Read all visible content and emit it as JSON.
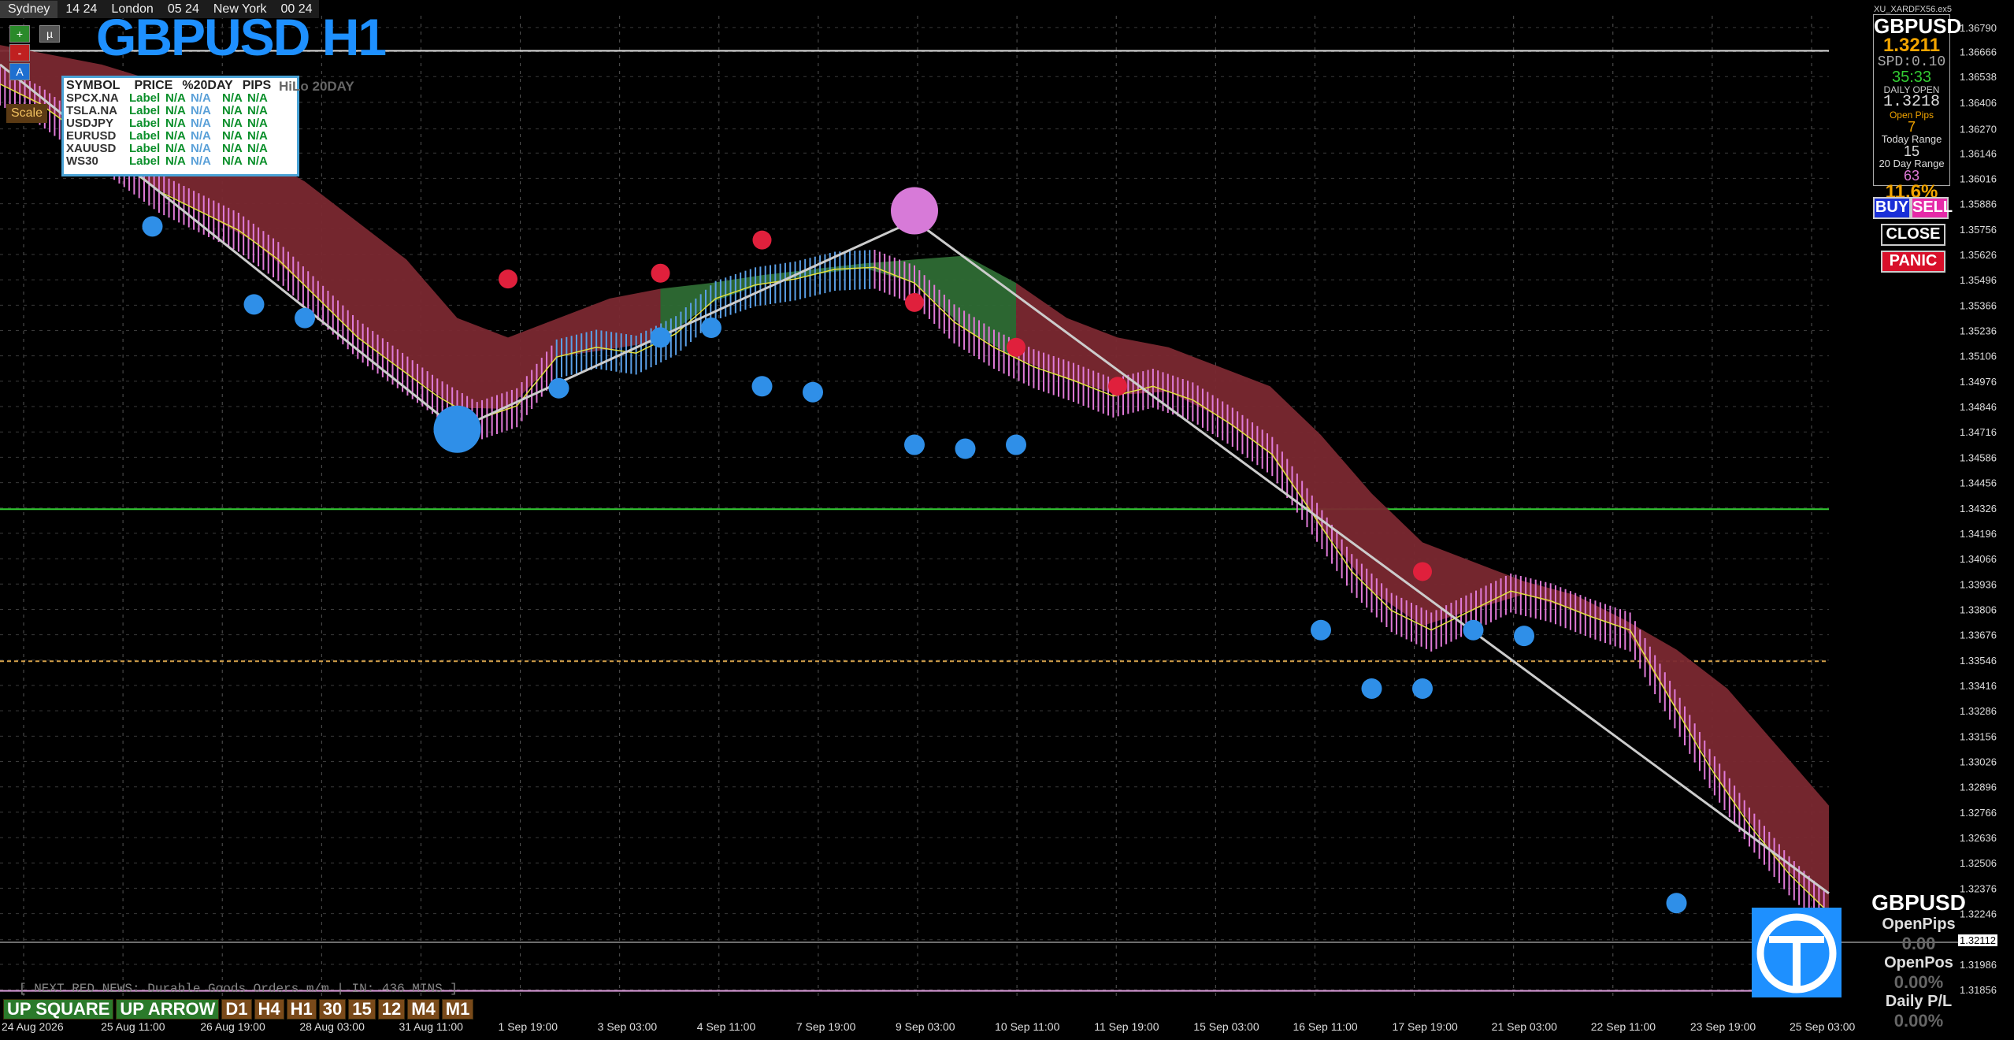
{
  "session": {
    "sydney_label": "Sydney",
    "sydney_time": "14 24",
    "london_label": "London",
    "london_time": "05 24",
    "ny_label": "New York",
    "ny_time": "00 24"
  },
  "title": "GBPUSD H1",
  "buttons": {
    "plus": "+",
    "mu": "µ",
    "minus": "-",
    "a": "A",
    "scale": "Scale"
  },
  "table": {
    "headers": [
      "SYMBOL",
      "PRICE",
      "%20DAY",
      "PIPS",
      "HiLo 20DAY"
    ],
    "rows": [
      {
        "symbol": "SPCX.NA",
        "price": "Label",
        "pct": "N/A",
        "pips": "N/A",
        "hilo": "N/A",
        "x": "N/A"
      },
      {
        "symbol": "TSLA.NA",
        "price": "Label",
        "pct": "N/A",
        "pips": "N/A",
        "hilo": "N/A",
        "x": "N/A"
      },
      {
        "symbol": "USDJPY",
        "price": "Label",
        "pct": "N/A",
        "pips": "N/A",
        "hilo": "N/A",
        "x": "N/A"
      },
      {
        "symbol": "EURUSD",
        "price": "Label",
        "pct": "N/A",
        "pips": "N/A",
        "hilo": "N/A",
        "x": "N/A"
      },
      {
        "symbol": "XAUUSD",
        "price": "Label",
        "pct": "N/A",
        "pips": "N/A",
        "hilo": "N/A",
        "x": "N/A"
      },
      {
        "symbol": "WS30",
        "price": "Label",
        "pct": "N/A",
        "pips": "N/A",
        "hilo": "N/A",
        "x": "N/A"
      }
    ]
  },
  "right_panel": {
    "broker": "XU_XARDFX56.ex5",
    "symbol": "GBPUSD",
    "price": "1.3211",
    "spread": "SPD:0.10",
    "timer": "35:33",
    "daily_open_label": "DAILY OPEN",
    "daily_open": "1.3218",
    "open_pips_label": "Open Pips",
    "open_pips": "7",
    "today_range_label": "Today Range",
    "today_range": "15",
    "day20_range_label": "20 Day Range",
    "day20_range": "63",
    "pct": "11.6%"
  },
  "trade_buttons": {
    "buy": "BUY",
    "sell": "SELL",
    "close": "CLOSE",
    "panic": "PANIC"
  },
  "bottom_panel": {
    "symbol": "GBPUSD",
    "open_pips_label": "OpenPips",
    "open_pips": "0.00",
    "open_pos_label": "OpenPos",
    "open_pos": "0.00%",
    "daily_pl_label": "Daily P/L",
    "daily_pl": "0.00%"
  },
  "news": "[ NEXT RED NEWS: Durable Goods Orders m/m | IN: 436 MINS ]",
  "timeframes": [
    "UP SQUARE",
    "UP ARROW",
    "D1",
    "H4",
    "H1",
    "30",
    "15",
    "12",
    "M4",
    "M1"
  ],
  "current_price": "1.32112",
  "colors": {
    "title": "#1e90ff",
    "bull_cloud": "#2e6b34",
    "bear_cloud": "#7a2830",
    "candles": "#e07ad8",
    "buy_dot": "#2f8fe8",
    "sell_dot": "#e0203c",
    "brown_dot": "#6b4a0a",
    "support": "#33cc33",
    "resistance": "#d4a14a",
    "bid_line": "#dddddd"
  },
  "chart_data": {
    "type": "line",
    "symbol": "GBPUSD",
    "timeframe": "H1",
    "y_ticks": [
      "1.36790",
      "1.36666",
      "1.36538",
      "1.36406",
      "1.36270",
      "1.36146",
      "1.36016",
      "1.35886",
      "1.35756",
      "1.35626",
      "1.35496",
      "1.35366",
      "1.35236",
      "1.35106",
      "1.34976",
      "1.34846",
      "1.34716",
      "1.34586",
      "1.34456",
      "1.34326",
      "1.34196",
      "1.34066",
      "1.33936",
      "1.33806",
      "1.33676",
      "1.33546",
      "1.33416",
      "1.33286",
      "1.33156",
      "1.33026",
      "1.32896",
      "1.32766",
      "1.32636",
      "1.32506",
      "1.32376",
      "1.32246",
      "1.32112",
      "1.31986",
      "1.31856"
    ],
    "x_ticks": [
      "24 Aug 2026",
      "25 Aug 11:00",
      "26 Aug 19:00",
      "28 Aug 03:00",
      "31 Aug 11:00",
      "1 Sep 19:00",
      "3 Sep 03:00",
      "4 Sep 11:00",
      "7 Sep 19:00",
      "9 Sep 03:00",
      "10 Sep 11:00",
      "11 Sep 19:00",
      "15 Sep 03:00",
      "16 Sep 11:00",
      "17 Sep 19:00",
      "21 Sep 03:00",
      "22 Sep 11:00",
      "23 Sep 19:00",
      "25 Sep 03:00"
    ],
    "ylim": [
      1.318,
      1.3685
    ],
    "price_series": [
      1.365,
      1.364,
      1.3625,
      1.361,
      1.3595,
      1.3585,
      1.3575,
      1.356,
      1.354,
      1.352,
      1.3505,
      1.349,
      1.3478,
      1.3485,
      1.351,
      1.3515,
      1.3512,
      1.3522,
      1.354,
      1.3547,
      1.355,
      1.3555,
      1.3556,
      1.3548,
      1.3528,
      1.3515,
      1.3505,
      1.3498,
      1.349,
      1.3495,
      1.3488,
      1.3475,
      1.346,
      1.343,
      1.34,
      1.338,
      1.337,
      1.338,
      1.339,
      1.3385,
      1.3377,
      1.337,
      1.3335,
      1.33,
      1.327,
      1.3245,
      1.3225
    ],
    "cloud_upper": [
      1.367,
      1.3665,
      1.366,
      1.3652,
      1.364,
      1.3615,
      1.36,
      1.358,
      1.356,
      1.353,
      1.352,
      1.353,
      1.354,
      1.3545,
      1.3548,
      1.3552,
      1.3555,
      1.3558,
      1.356,
      1.3562,
      1.3548,
      1.353,
      1.352,
      1.3515,
      1.3505,
      1.3495,
      1.347,
      1.344,
      1.3415,
      1.3405,
      1.3395,
      1.3388,
      1.3375,
      1.336,
      1.334,
      1.331,
      1.328
    ],
    "levels": {
      "support": 1.3432,
      "resistance": 1.3354,
      "top": 1.3667,
      "bottom": 1.3185
    },
    "zigzag": [
      [
        0,
        1.366
      ],
      [
        9,
        1.3473
      ],
      [
        18,
        1.358
      ],
      [
        36,
        1.3235
      ]
    ],
    "buy_signals": [
      [
        3,
        1.3577
      ],
      [
        5,
        1.3537
      ],
      [
        6,
        1.353
      ],
      [
        9,
        1.3475
      ],
      [
        11,
        1.3494
      ],
      [
        13,
        1.352
      ],
      [
        14,
        1.3525
      ],
      [
        15,
        1.3495
      ],
      [
        16,
        1.3492
      ],
      [
        18,
        1.3465
      ],
      [
        19,
        1.3463
      ],
      [
        20,
        1.3465
      ],
      [
        26,
        1.337
      ],
      [
        27,
        1.334
      ],
      [
        28,
        1.334
      ],
      [
        29,
        1.337
      ],
      [
        30,
        1.3367
      ],
      [
        33,
        1.323
      ]
    ],
    "sell_signals": [
      [
        10,
        1.355
      ],
      [
        13,
        1.3553
      ],
      [
        15,
        1.357
      ],
      [
        18,
        1.3538
      ],
      [
        20,
        1.3515
      ],
      [
        22,
        1.3495
      ],
      [
        28,
        1.34
      ]
    ],
    "title": "GBPUSD H1"
  }
}
